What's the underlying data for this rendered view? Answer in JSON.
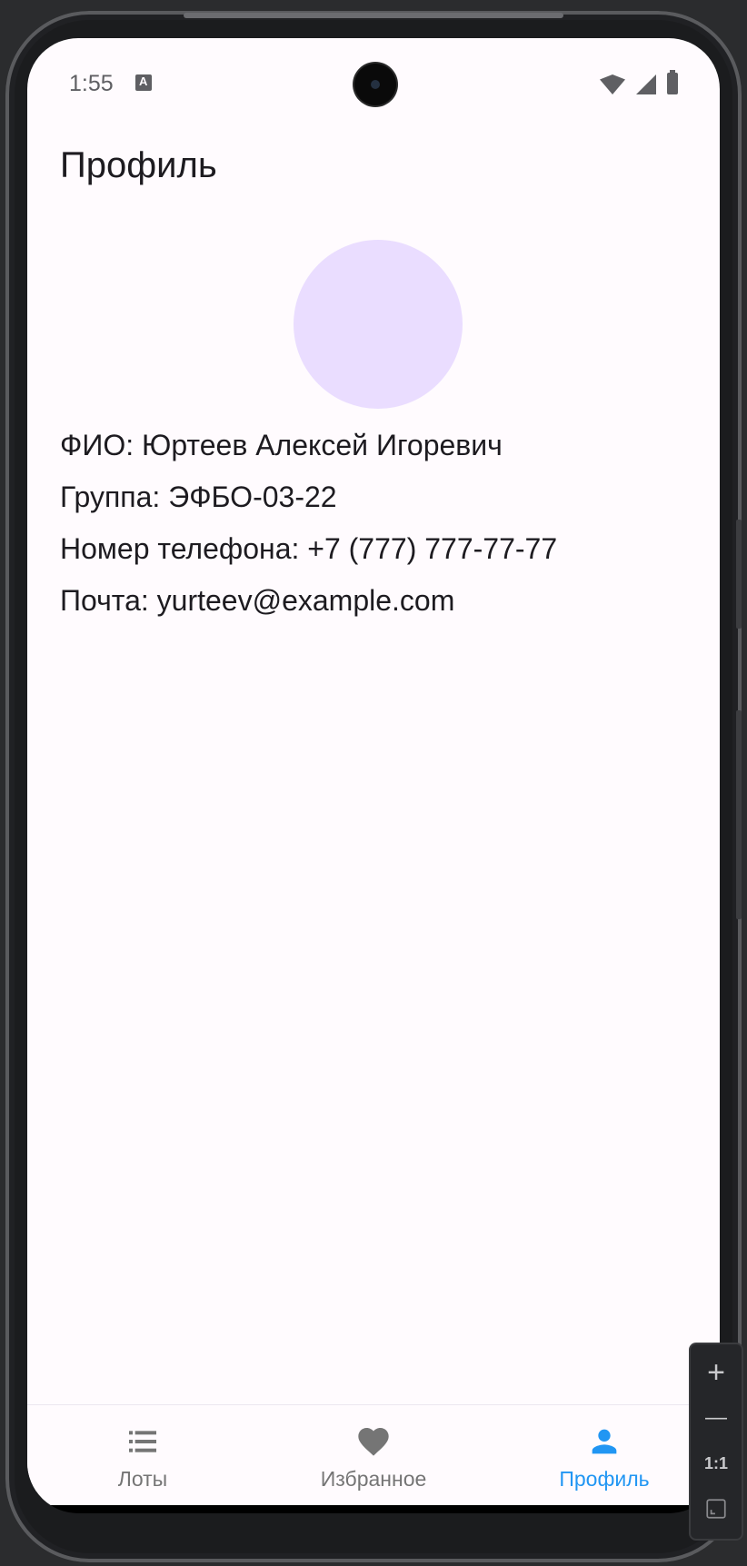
{
  "status_bar": {
    "time": "1:55"
  },
  "header": {
    "title": "Профиль"
  },
  "profile": {
    "fio": "ФИО: Юртеев Алексей Игоревич",
    "group": "Группа: ЭФБО-03-22",
    "phone": "Номер телефона: +7 (777) 777-77-77",
    "email": "Почта: yurteev@example.com",
    "avatar_color": "#eaddff"
  },
  "bottom_nav": {
    "items": [
      {
        "label": "Лоты",
        "icon": "list-icon",
        "active": false
      },
      {
        "label": "Избранное",
        "icon": "heart-icon",
        "active": false
      },
      {
        "label": "Профиль",
        "icon": "person-icon",
        "active": true
      }
    ],
    "active_color": "#2196f3",
    "inactive_color": "#757575"
  },
  "emulator_zoom": {
    "zoom_in": "+",
    "zoom_out": "—",
    "actual_size": "1:1"
  }
}
